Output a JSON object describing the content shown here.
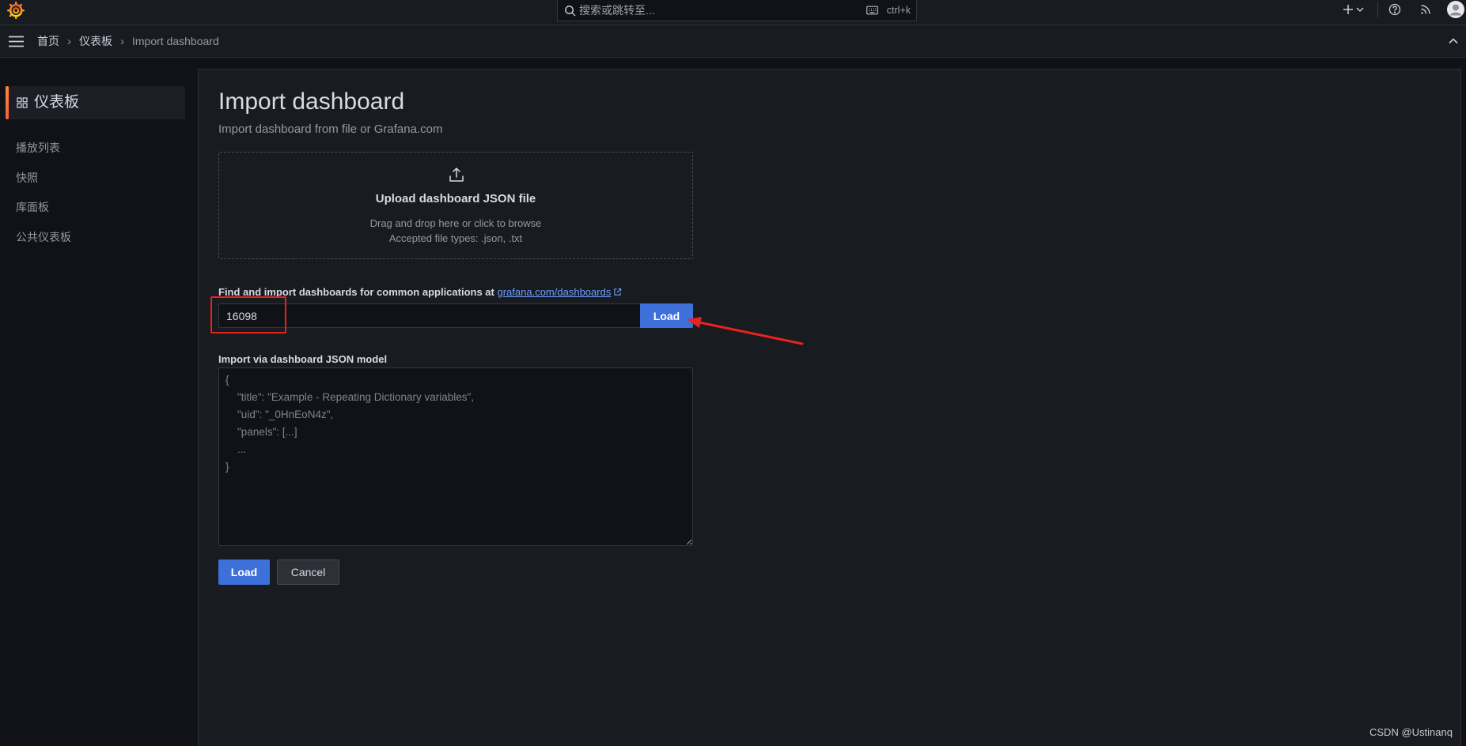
{
  "colors": {
    "background": "#111217",
    "panel": "#181b1f",
    "primary": "#3d71d9",
    "link": "#6e9fff",
    "brand": "#ff7a2e",
    "annotation": "#e8221f"
  },
  "icons": {
    "logo": "grafana-logo-icon",
    "search": "search-icon",
    "keyboard": "keyboard-icon",
    "add": "plus-icon",
    "help": "help-icon",
    "news": "rss-icon",
    "profile": "avatar-icon",
    "menu": "hamburger-icon",
    "collapse": "chevron-up-icon",
    "dashboards": "grid-icon",
    "upload": "upload-icon",
    "external": "external-link-icon"
  },
  "topbar": {
    "search_placeholder": "搜索或跳转至...",
    "search_shortcut": "ctrl+k"
  },
  "breadcrumb": {
    "home": "首页",
    "dashboards": "仪表板",
    "current": "Import dashboard",
    "separator": "›"
  },
  "sidebar": {
    "title": "仪表板",
    "items": [
      {
        "label": "播放列表"
      },
      {
        "label": "快照"
      },
      {
        "label": "库面板"
      },
      {
        "label": "公共仪表板"
      }
    ]
  },
  "page": {
    "title": "Import dashboard",
    "subtitle": "Import dashboard from file or Grafana.com",
    "upload": {
      "title": "Upload dashboard JSON file",
      "hint": "Drag and drop here or click to browse",
      "accepted": "Accepted file types: .json, .txt"
    },
    "grafana_com": {
      "label": "Find and import dashboards for common applications at",
      "link_text": "grafana.com/dashboards",
      "value": "16098",
      "load_label": "Load"
    },
    "json_model": {
      "label": "Import via dashboard JSON model",
      "placeholder": "{\n    \"title\": \"Example - Repeating Dictionary variables\",\n    \"uid\": \"_0HnEoN4z\",\n    \"panels\": [...]\n    ...\n}"
    },
    "actions": {
      "load_label": "Load",
      "cancel_label": "Cancel"
    }
  },
  "watermark": "CSDN @Ustinanq"
}
